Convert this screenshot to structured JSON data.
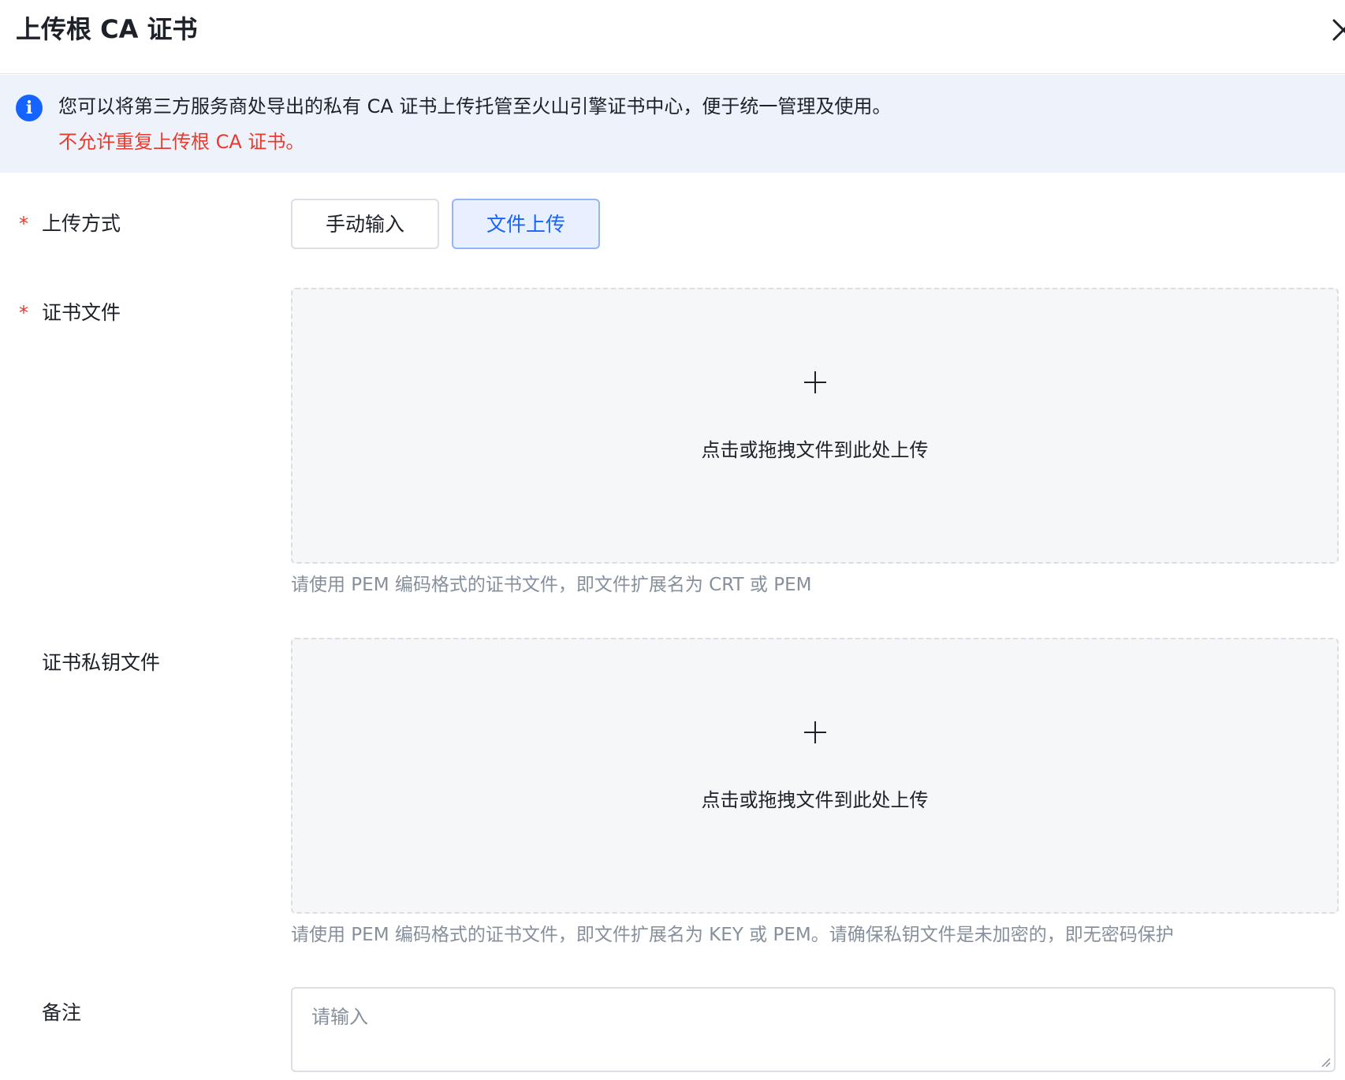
{
  "dialog": {
    "title": "上传根 CA 证书",
    "close_icon": "close-icon"
  },
  "notice": {
    "icon": "info-icon",
    "icon_glyph": "i",
    "line1": "您可以将第三方服务商处导出的私有 CA 证书上传托管至火山引擎证书中心，便于统一管理及使用。",
    "line2": "不允许重复上传根 CA 证书。",
    "line2_color": "#e63b2e",
    "background": "#eef2fb"
  },
  "form": {
    "required_mark": "*",
    "upload_method": {
      "label": "上传方式",
      "required": true,
      "options": [
        "手动输入",
        "文件上传"
      ],
      "selected": "文件上传"
    },
    "cert_file": {
      "label": "证书文件",
      "required": true,
      "dropzone_text": "点击或拖拽文件到此处上传",
      "hint": "请使用 PEM 编码格式的证书文件，即文件扩展名为 CRT 或 PEM"
    },
    "private_key_file": {
      "label": "证书私钥文件",
      "required": false,
      "dropzone_text": "点击或拖拽文件到此处上传",
      "hint": "请使用 PEM 编码格式的证书文件，即文件扩展名为 KEY 或 PEM。请确保私钥文件是未加密的，即无密码保护"
    },
    "remark": {
      "label": "备注",
      "placeholder": "请输入",
      "value": ""
    }
  },
  "colors": {
    "accent": "#1664ff",
    "required": "#e63b2e",
    "hint_text": "#86909c",
    "dropzone_bg": "#f6f7f9"
  }
}
